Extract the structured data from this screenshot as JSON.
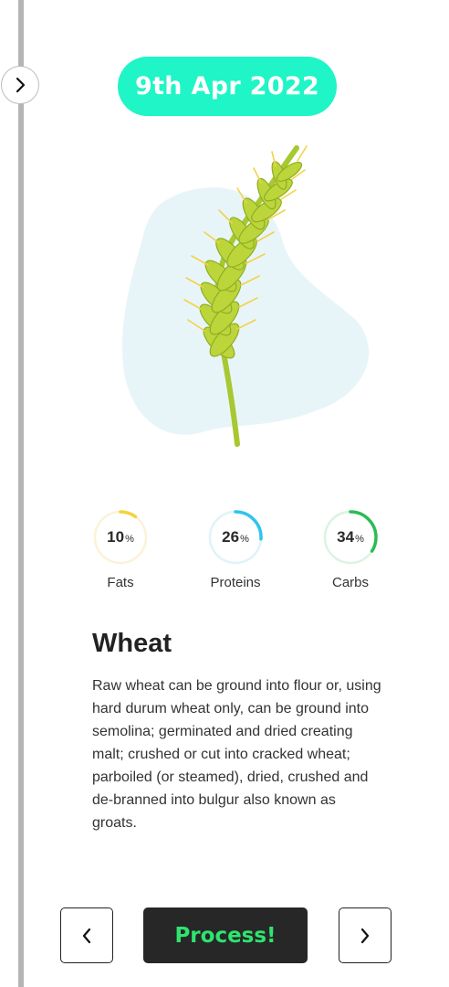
{
  "date": "9th Apr 2022",
  "food": {
    "name": "Wheat",
    "description": "Raw wheat can be ground into flour or, using hard durum wheat only, can be ground into semolina; germinated and dried creating malt; crushed or cut into cracked wheat; parboiled (or steamed), dried, crushed and de-branned into bulgur also known as groats."
  },
  "nutrients": [
    {
      "label": "Fats",
      "value": "10",
      "unit": "%",
      "fraction": 0.1,
      "color": "#f5d23a",
      "track": "#fbf2d8"
    },
    {
      "label": "Proteins",
      "value": "26",
      "unit": "%",
      "fraction": 0.26,
      "color": "#2ec4ee",
      "track": "#dff3f9"
    },
    {
      "label": "Carbs",
      "value": "34",
      "unit": "%",
      "fraction": 0.34,
      "color": "#2dbb55",
      "track": "#dcf3e2"
    }
  ],
  "buttons": {
    "process": "Process!"
  },
  "icons": {
    "side_toggle": "chevron-right-icon",
    "prev": "chevron-left-icon",
    "next": "chevron-right-icon",
    "illustration": "wheat-icon"
  },
  "colors": {
    "date_pill": "#1ff5c6",
    "process_text": "#2ee46f",
    "process_bg": "#272727",
    "blob": "#e8f5f8"
  }
}
